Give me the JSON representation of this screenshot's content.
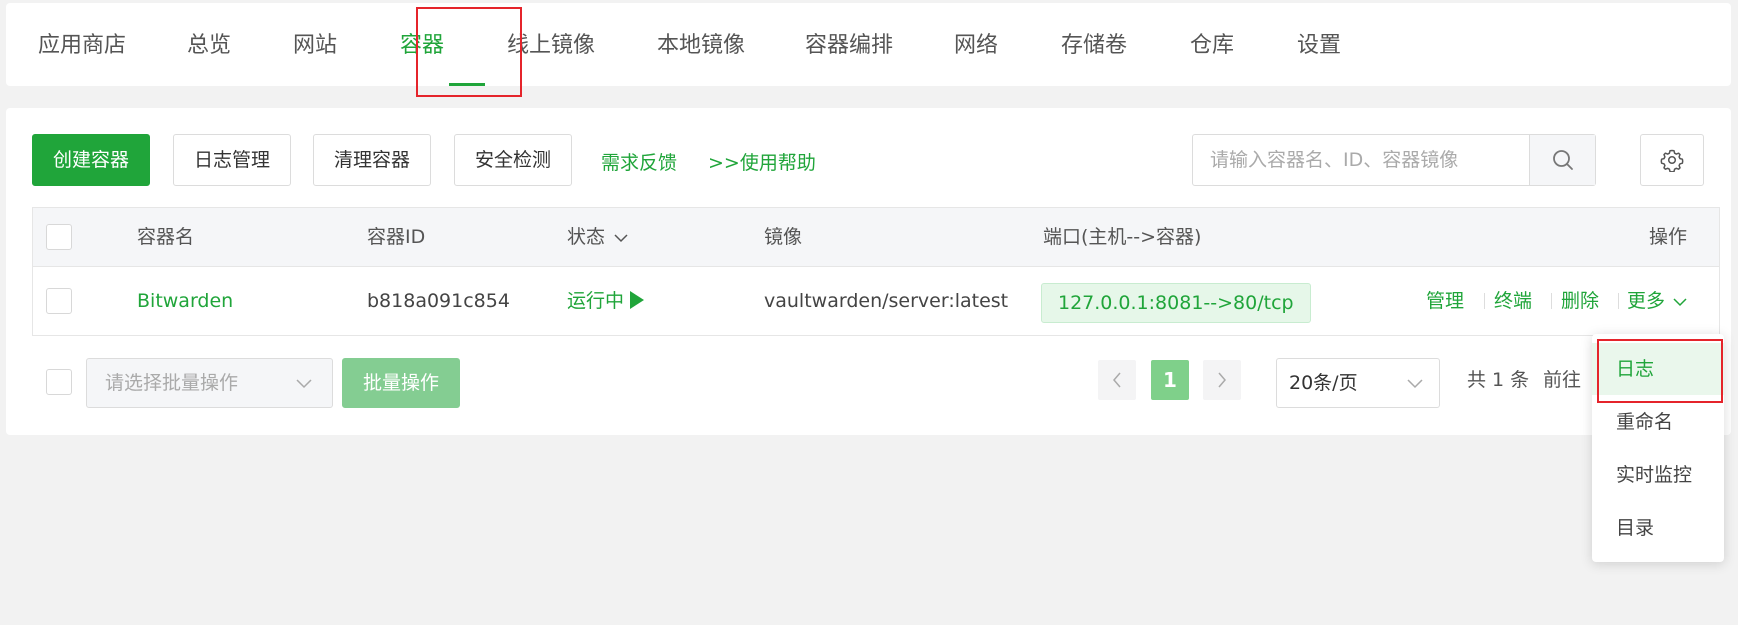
{
  "nav": {
    "tabs": [
      "应用商店",
      "总览",
      "网站",
      "容器",
      "线上镜像",
      "本地镜像",
      "容器编排",
      "网络",
      "存储卷",
      "仓库",
      "设置"
    ],
    "active_tab": "容器"
  },
  "toolbar": {
    "create_label": "创建容器",
    "logs_label": "日志管理",
    "clean_label": "清理容器",
    "security_label": "安全检测",
    "feedback_label": "需求反馈",
    "help_label": ">>使用帮助"
  },
  "search": {
    "placeholder": "请输入容器名、ID、容器镜像",
    "value": ""
  },
  "icons": {
    "search": "search-icon",
    "settings": "gear-icon",
    "chevron": "chevron-down-icon",
    "play": "play-icon"
  },
  "colors": {
    "accent": "#20a53a",
    "highlight": "#e5242b"
  },
  "table": {
    "headers": {
      "name": "容器名",
      "id": "容器ID",
      "status": "状态",
      "image": "镜像",
      "ports": "端口(主机-->容器)",
      "actions": "操作"
    },
    "rows": [
      {
        "name": "Bitwarden",
        "id": "b818a091c854",
        "status": "运行中",
        "image": "vaultwarden/server:latest",
        "ports": "127.0.0.1:8081-->80/tcp",
        "actions": [
          "管理",
          "终端",
          "删除",
          "更多"
        ]
      }
    ]
  },
  "batch": {
    "placeholder": "请选择批量操作",
    "button_label": "批量操作"
  },
  "pagination": {
    "current_page": "1",
    "page_size": "20条/页",
    "total_text": "共 1 条",
    "goto_text": "前往"
  },
  "more_menu": {
    "items": [
      "日志",
      "重命名",
      "实时监控",
      "目录"
    ],
    "highlighted": "日志"
  }
}
